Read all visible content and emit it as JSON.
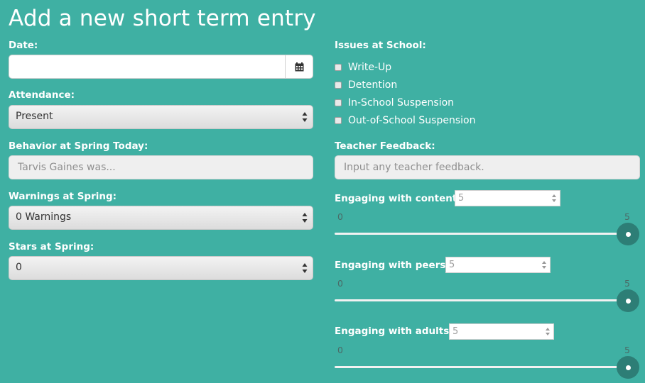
{
  "page_title": "Add a new short term entry",
  "date": {
    "label": "Date:",
    "value": ""
  },
  "attendance": {
    "label": "Attendance:",
    "selected": "Present"
  },
  "behavior": {
    "label": "Behavior at Spring Today:",
    "placeholder": "Tarvis Gaines was..."
  },
  "warnings": {
    "label": "Warnings at Spring:",
    "selected": "0 Warnings"
  },
  "stars": {
    "label": "Stars at Spring:",
    "selected": "0"
  },
  "issues": {
    "label": "Issues at School:",
    "options": [
      {
        "label": "Write-Up",
        "checked": false
      },
      {
        "label": "Detention",
        "checked": false
      },
      {
        "label": "In-School Suspension",
        "checked": false
      },
      {
        "label": "Out-of-School Suspension",
        "checked": false
      }
    ]
  },
  "teacher_feedback": {
    "label": "Teacher Feedback:",
    "placeholder": "Input any teacher feedback."
  },
  "sliders": [
    {
      "label": "Engaging with content:",
      "value": "5",
      "min": "0",
      "max": "5"
    },
    {
      "label": "Engaging with peers:",
      "value": "5",
      "min": "0",
      "max": "5"
    },
    {
      "label": "Engaging with adults:",
      "value": "5",
      "min": "0",
      "max": "5"
    }
  ],
  "colors": {
    "background": "#3fb0a3",
    "slider_knob": "#2d7e76"
  },
  "icons": {
    "date_picker": "calendar-icon",
    "select_arrows": "updown-arrows-icon"
  }
}
